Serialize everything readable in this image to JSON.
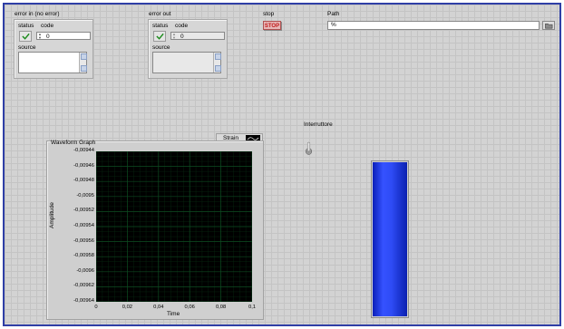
{
  "error_in": {
    "title": "error in (no error)",
    "status_label": "status",
    "code_label": "code",
    "code_value": "0",
    "source_label": "source",
    "status_ok": true
  },
  "error_out": {
    "title": "error out",
    "status_label": "status",
    "code_label": "code",
    "code_value": "0",
    "source_label": "source",
    "status_ok": true
  },
  "stop": {
    "label": "stop",
    "button_text": "STOP"
  },
  "path": {
    "label": "Path",
    "value": "%"
  },
  "graph": {
    "title": "Waveform Graph",
    "legend_label": "Strain",
    "ylabel": "Amplitude",
    "xlabel": "Time",
    "yticks": [
      "-0,00944",
      "-0,00946",
      "-0,00948",
      "-0,0095",
      "-0,00952",
      "-0,00954",
      "-0,00956",
      "-0,00958",
      "-0,0096",
      "-0,00962",
      "-0,00964"
    ],
    "xticks": [
      "0",
      "0,02",
      "0,04",
      "0,06",
      "0,08",
      "0,1"
    ]
  },
  "switch": {
    "label": "Interruttore",
    "state": "off"
  },
  "tank": {
    "level": 1.0,
    "color": "#2a45f0"
  },
  "colors": {
    "accent_frame": "#2f3fa6",
    "stop_text": "#c01818",
    "plot_grid": "#0d4a20",
    "plot_bg": "#000000"
  }
}
